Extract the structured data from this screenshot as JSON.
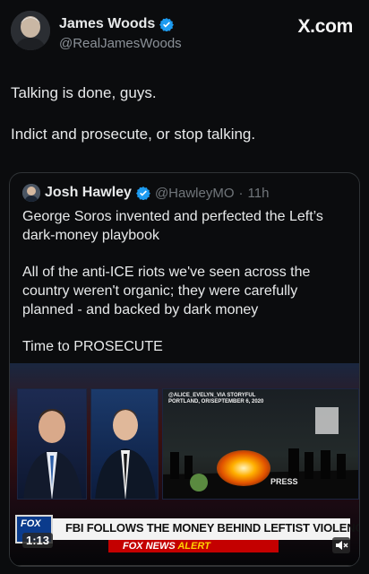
{
  "header": {
    "name": "James Woods",
    "handle": "@RealJamesWoods",
    "brand": "X.com"
  },
  "tweet": {
    "line1": "Talking is done, guys.",
    "line2": "Indict and prosecute, or stop talking."
  },
  "quote": {
    "name": "Josh Hawley",
    "handle": "@HawleyMO",
    "sep": "·",
    "time": "11h",
    "para1": "George Soros invented and perfected the Left’s dark-money playbook",
    "para2": "All of the anti-ICE riots we've seen across the country weren't organic; they were carefully planned - and backed by dark money",
    "para3": "Time to PROSECUTE"
  },
  "video": {
    "credit1": "@ALICE_EVELYN_VIA STORYFUL",
    "credit2": "PORTLAND, OR/SEPTEMBER 6, 2020",
    "press": "PRESS",
    "headline": "FBI FOLLOWS THE MONEY BEHIND LEFTIST VIOLENCE",
    "alert_left": "FOX NEWS",
    "alert_right": "ALERT",
    "logo": "FOX",
    "timestamp": "1:13"
  },
  "colors": {
    "verified": "#1d9bf0",
    "background": "#0b0c0e",
    "alert": "#c40000"
  }
}
